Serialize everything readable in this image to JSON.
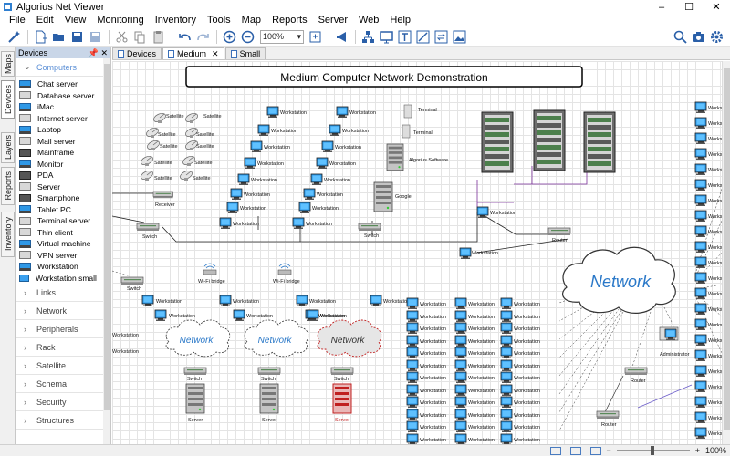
{
  "window": {
    "title": "Algorius Net Viewer"
  },
  "menu": [
    "File",
    "Edit",
    "View",
    "Monitoring",
    "Inventory",
    "Tools",
    "Map",
    "Reports",
    "Server",
    "Web",
    "Help"
  ],
  "toolbar": {
    "zoom_value": "100%"
  },
  "vertical_tabs": [
    "Maps",
    "Devices",
    "Layers",
    "Reports",
    "Inventory"
  ],
  "devices_panel": {
    "title": "Devices",
    "open_category": "Computers",
    "items": [
      "Chat server",
      "Database server",
      "iMac",
      "Internet server",
      "Laptop",
      "Mail server",
      "Mainframe",
      "Monitor",
      "PDA",
      "Server",
      "Smartphone",
      "Tablet PC",
      "Terminal server",
      "Thin client",
      "Virtual machine",
      "VPN server",
      "Workstation",
      "Workstation small"
    ],
    "categories": [
      "Links",
      "Network",
      "Peripherals",
      "Rack",
      "Satellite",
      "Schema",
      "Security",
      "Structures"
    ]
  },
  "doc_tabs": [
    "Devices",
    "Medium",
    "Small"
  ],
  "diagram": {
    "title": "Medium Computer Network Demonstration",
    "labels": {
      "satellite": "Satellite",
      "receiver": "Receiver",
      "switch": "Switch",
      "workstation": "Workstation",
      "terminal": "Terminal",
      "algorius_software": "Algorius Software",
      "google": "Google",
      "router": "Router",
      "wifi_bridge": "Wi-Fi bridge",
      "network": "Network",
      "server": "Server",
      "administrator": "Administrator"
    }
  },
  "status": {
    "zoom": "100%"
  },
  "colors": {
    "panel_header": "#c9d6e8",
    "accent": "#5b8fd6",
    "monitor": "#2f98e6",
    "purple_link": "#7a2f9a",
    "red_server": "#d42020"
  }
}
